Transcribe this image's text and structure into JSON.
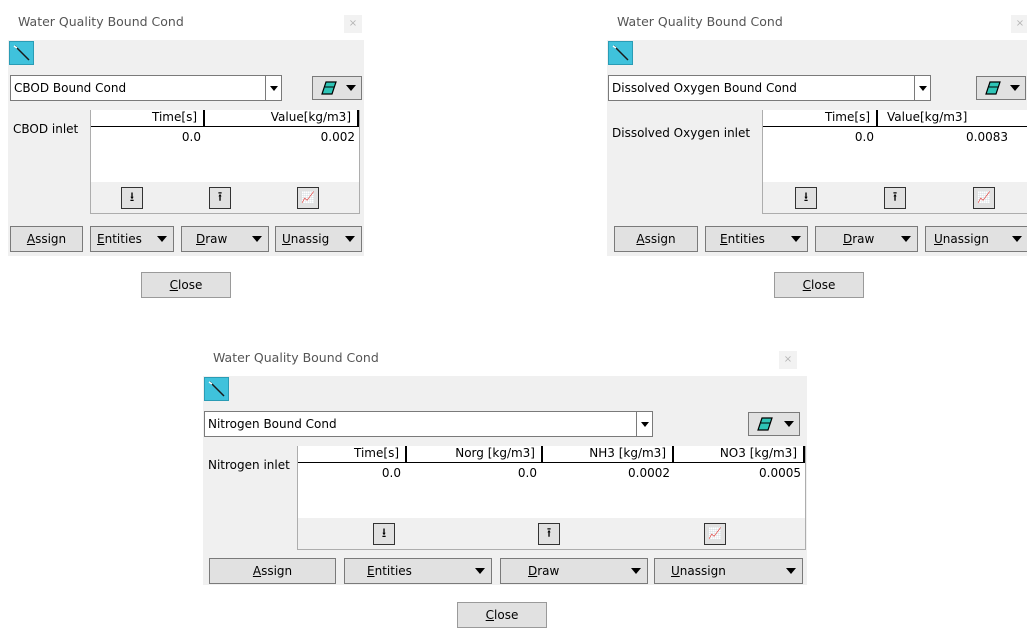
{
  "dialogs": [
    {
      "title": "Water Quality Bound Cond",
      "close_x": "×",
      "combo_value": "CBOD Bound Cond",
      "condition_label": "CBOD inlet",
      "columns": [
        "Time[s]",
        "Value[kg/m3]"
      ],
      "rows": [
        [
          "0.0",
          "0.002"
        ]
      ],
      "buttons": {
        "assign": "Assign",
        "entities": "Entities",
        "draw": "Draw",
        "unassign": "Unassig"
      },
      "close_label": "Close"
    },
    {
      "title": "Water Quality Bound Cond",
      "close_x": "×",
      "combo_value": "Dissolved Oxygen Bound Cond",
      "condition_label": "Dissolved Oxygen inlet",
      "columns": [
        "Time[s]",
        "Value[kg/m3]"
      ],
      "rows": [
        [
          "0.0",
          "0.0083"
        ]
      ],
      "buttons": {
        "assign": "Assign",
        "entities": "Entities",
        "draw": "Draw",
        "unassign": "Unassign"
      },
      "close_label": "Close"
    },
    {
      "title": "Water Quality Bound Cond",
      "close_x": "×",
      "combo_value": "Nitrogen Bound Cond",
      "condition_label": "Nitrogen inlet",
      "columns": [
        "Time[s]",
        "Norg [kg/m3]",
        "NH3 [kg/m3]",
        "NO3 [kg/m3]"
      ],
      "rows": [
        [
          "0.0",
          "0.0",
          "0.0002",
          "0.0005"
        ]
      ],
      "buttons": {
        "assign": "Assign",
        "entities": "Entities",
        "draw": "Draw",
        "unassign": "Unassign"
      },
      "close_label": "Close"
    }
  ],
  "icons": {
    "wand": "wand-icon",
    "eraser": "eraser-icon",
    "download": "download-icon",
    "upload": "upload-icon",
    "graph": "graph-icon",
    "download_glyph": "⭳",
    "upload_glyph": "⭱",
    "graph_glyph": "📈"
  },
  "colors": {
    "accent": "#3fc2dc",
    "eraser": "#2ec4b6"
  }
}
